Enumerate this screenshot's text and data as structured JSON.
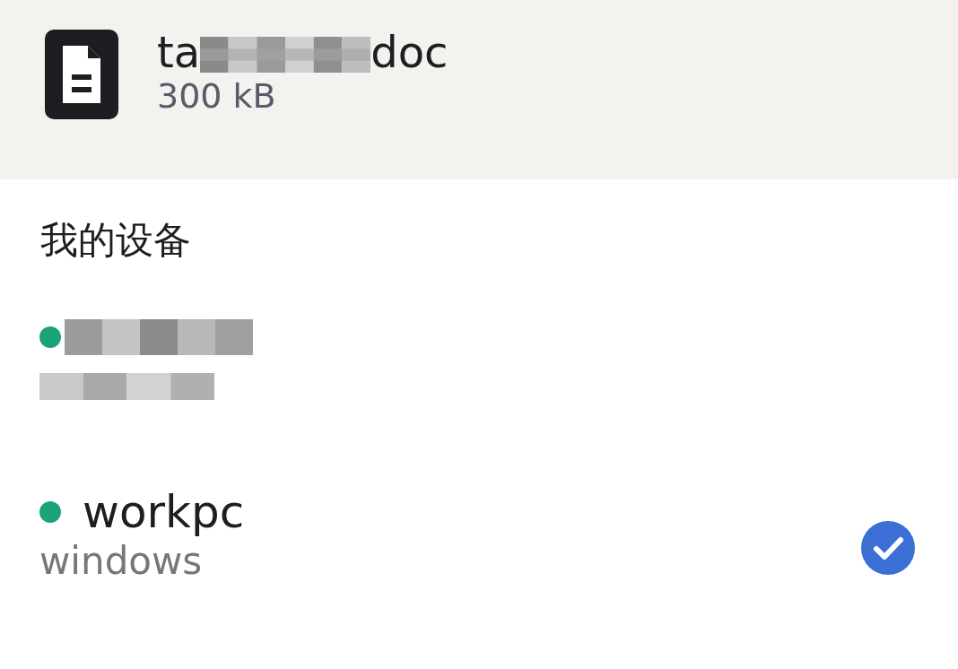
{
  "file": {
    "name_start": "ta",
    "name_end": "doc",
    "name_redacted": true,
    "size": "300 kB"
  },
  "section_title": "我的设备",
  "devices": [
    {
      "kind": "redacted",
      "online": true,
      "selected": false
    },
    {
      "kind": "named",
      "name": "workpc",
      "os": "windows",
      "online": true,
      "selected": true
    }
  ]
}
